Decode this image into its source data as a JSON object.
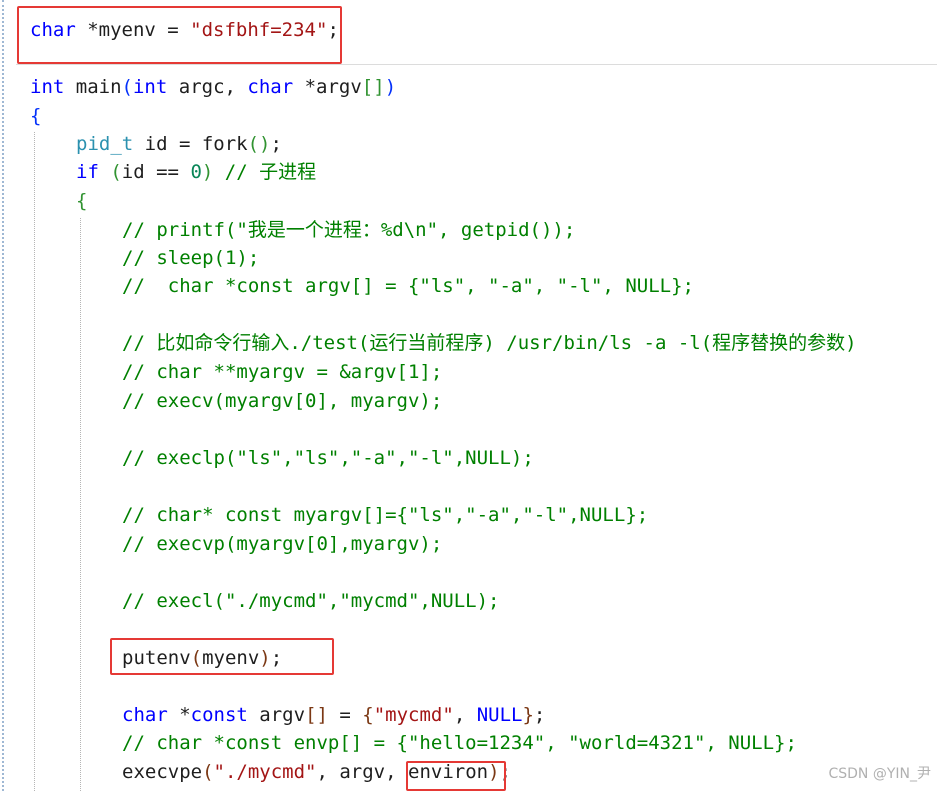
{
  "code": {
    "l1": {
      "kw": "char",
      "rest": " *myenv = ",
      "str": "\"dsfbhf=234\"",
      "end": ";"
    },
    "l2": {
      "kw1": "int",
      "sp1": " main",
      "p1": "(",
      "kw2": "int",
      "sp2": " argc, ",
      "kw3": "char",
      "sp3": " *argv",
      "p2": "[]",
      "p3": ")"
    },
    "l3": {
      "brace": "{"
    },
    "l4": {
      "type": "pid_t",
      "rest": " id = fork",
      "p": "()",
      "end": ";"
    },
    "l5": {
      "kw": "if",
      "sp": " ",
      "p1": "(",
      "rest": "id == ",
      "num": "0",
      "p2": ")",
      "cm": " // 子进程"
    },
    "l6": {
      "brace": "{"
    },
    "l7": "// printf(\"我是一个进程：%d\\n\", getpid());",
    "l8": "// sleep(1);",
    "l9": "//  char *const argv[] = {\"ls\", \"-a\", \"-l\", NULL};",
    "l10": "// 比如命令行输入./test(运行当前程序) /usr/bin/ls -a -l(程序替换的参数)",
    "l11": "// char **myargv = &argv[1];",
    "l12": "// execv(myargv[0], myargv);",
    "l13": "// execlp(\"ls\",\"ls\",\"-a\",\"-l\",NULL);",
    "l14": "// char* const myargv[]={\"ls\",\"-a\",\"-l\",NULL};",
    "l15": "// execvp(myargv[0],myargv);",
    "l16": "// execl(\"./mycmd\",\"mycmd\",NULL);",
    "l17": {
      "fn": "putenv",
      "p1": "(",
      "arg": "myenv",
      "p2": ")",
      "end": ";"
    },
    "l18": {
      "kw": "char",
      "rest1": " *",
      "kw2": "const",
      "rest2": " argv",
      "p1": "[]",
      "rest3": " = ",
      "b1": "{",
      "str": "\"mycmd\"",
      "rest4": ", ",
      "kw3": "NULL",
      "b2": "}",
      "end": ";"
    },
    "l19": "// char *const envp[] = {\"hello=1234\", \"world=4321\", NULL};",
    "l20": {
      "fn": "execvpe",
      "p1": "(",
      "str": "\"./mycmd\"",
      "rest": ", argv, ",
      "arg": "environ",
      "p2": ")",
      "end": ";"
    }
  },
  "watermark": "CSDN @YIN_尹",
  "colors": {
    "keyword": "#0000ff",
    "string": "#a31515",
    "comment": "#008000",
    "highlight": "#e53935"
  }
}
